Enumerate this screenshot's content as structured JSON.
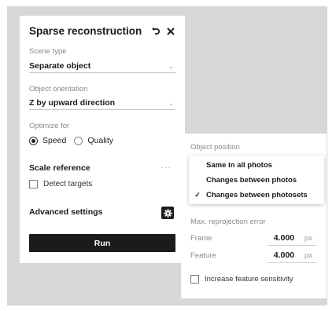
{
  "panel": {
    "title": "Sparse reconstruction",
    "scene_type": {
      "label": "Scene type",
      "value": "Separate object"
    },
    "object_orientation": {
      "label": "Object orientation",
      "value": "Z by upward direction"
    },
    "optimize_for": {
      "label": "Optimize for",
      "options": [
        "Speed",
        "Quality"
      ],
      "selected": "Speed"
    },
    "scale_reference": {
      "title": "Scale reference",
      "detect_targets": "Detect targets"
    },
    "advanced_settings": "Advanced settings",
    "run_label": "Run"
  },
  "advanced": {
    "object_position_label": "Object position",
    "dropdown_options": [
      "Same in all photos",
      "Changes between photos",
      "Changes between photosets"
    ],
    "selected_option": "Changes between photosets",
    "max_reprojection_label": "Max. reprojection error",
    "frame": {
      "label": "Frame",
      "value": "4.000",
      "unit": "px"
    },
    "feature": {
      "label": "Feature",
      "value": "4.000",
      "unit": "px"
    },
    "increase_sensitivity": "Increase feature sensitivity"
  },
  "icons": [
    "undo-icon",
    "close-icon",
    "chevron-down-icon",
    "ellipsis-icon",
    "gear-icon",
    "checkmark-icon"
  ]
}
